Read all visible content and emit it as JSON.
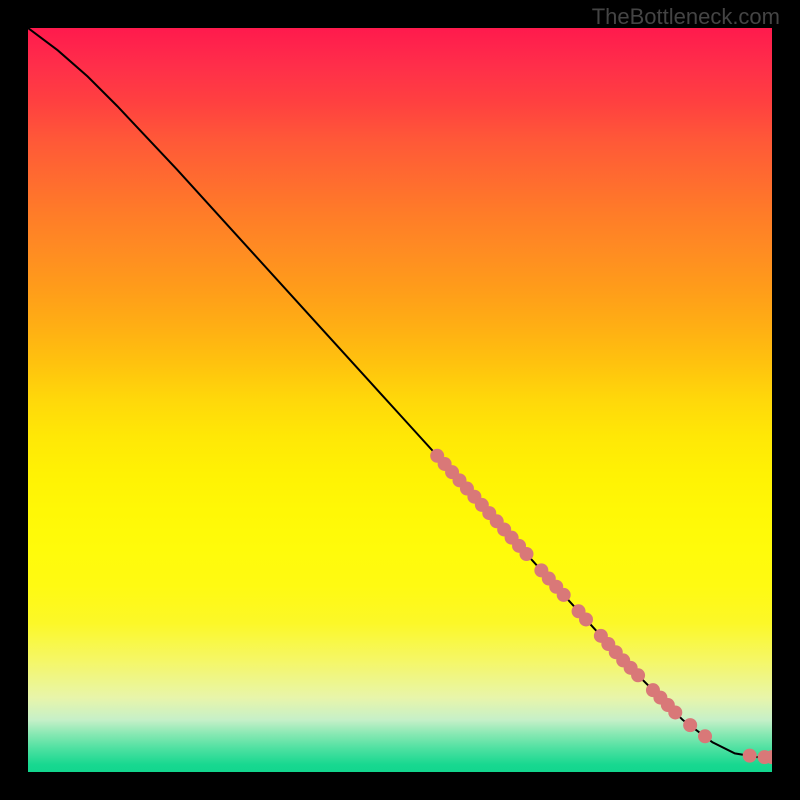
{
  "watermark": "TheBottleneck.com",
  "chart_data": {
    "type": "line",
    "title": "",
    "xlabel": "",
    "ylabel": "",
    "xlim": [
      0,
      100
    ],
    "ylim": [
      0,
      100
    ],
    "gradient_colors": {
      "top": "#ff1a4d",
      "mid_top": "#ff8c22",
      "mid": "#ffe806",
      "mid_bottom": "#fffb0a",
      "bottom": "#12d68e"
    },
    "curve": {
      "points": [
        {
          "x": 0,
          "y": 100
        },
        {
          "x": 4,
          "y": 97
        },
        {
          "x": 8,
          "y": 93.5
        },
        {
          "x": 12,
          "y": 89.5
        },
        {
          "x": 20,
          "y": 81
        },
        {
          "x": 30,
          "y": 70
        },
        {
          "x": 40,
          "y": 59
        },
        {
          "x": 50,
          "y": 48
        },
        {
          "x": 60,
          "y": 37
        },
        {
          "x": 70,
          "y": 26
        },
        {
          "x": 80,
          "y": 15
        },
        {
          "x": 88,
          "y": 7
        },
        {
          "x": 92,
          "y": 4
        },
        {
          "x": 95,
          "y": 2.5
        },
        {
          "x": 98,
          "y": 2
        },
        {
          "x": 100,
          "y": 2
        }
      ]
    },
    "marker_clusters": [
      {
        "x_start": 55,
        "x_end": 67,
        "density": "high"
      },
      {
        "x_start": 68,
        "x_end": 75,
        "density": "high"
      },
      {
        "x_start": 76,
        "x_end": 82,
        "density": "medium"
      },
      {
        "x_start": 83,
        "x_end": 88,
        "density": "medium"
      },
      {
        "x_start": 89,
        "x_end": 91,
        "density": "low"
      },
      {
        "x_start": 97,
        "x_end": 100,
        "density": "low"
      }
    ],
    "markers": [
      {
        "x": 55,
        "y": 42.5
      },
      {
        "x": 56,
        "y": 41.4
      },
      {
        "x": 57,
        "y": 40.3
      },
      {
        "x": 58,
        "y": 39.2
      },
      {
        "x": 59,
        "y": 38.1
      },
      {
        "x": 60,
        "y": 37.0
      },
      {
        "x": 61,
        "y": 35.9
      },
      {
        "x": 62,
        "y": 34.8
      },
      {
        "x": 63,
        "y": 33.7
      },
      {
        "x": 64,
        "y": 32.6
      },
      {
        "x": 65,
        "y": 31.5
      },
      {
        "x": 66,
        "y": 30.4
      },
      {
        "x": 67,
        "y": 29.3
      },
      {
        "x": 69,
        "y": 27.1
      },
      {
        "x": 70,
        "y": 26.0
      },
      {
        "x": 71,
        "y": 24.9
      },
      {
        "x": 72,
        "y": 23.8
      },
      {
        "x": 74,
        "y": 21.6
      },
      {
        "x": 75,
        "y": 20.5
      },
      {
        "x": 77,
        "y": 18.3
      },
      {
        "x": 78,
        "y": 17.2
      },
      {
        "x": 79,
        "y": 16.1
      },
      {
        "x": 80,
        "y": 15.0
      },
      {
        "x": 81,
        "y": 14.0
      },
      {
        "x": 82,
        "y": 13.0
      },
      {
        "x": 84,
        "y": 11.0
      },
      {
        "x": 85,
        "y": 10.0
      },
      {
        "x": 86,
        "y": 9.0
      },
      {
        "x": 87,
        "y": 8.0
      },
      {
        "x": 89,
        "y": 6.3
      },
      {
        "x": 91,
        "y": 4.8
      },
      {
        "x": 97,
        "y": 2.2
      },
      {
        "x": 99,
        "y": 2.0
      },
      {
        "x": 100,
        "y": 2.0
      }
    ],
    "marker_color": "#d97878",
    "marker_radius_px": 7,
    "curve_color": "#000000"
  }
}
